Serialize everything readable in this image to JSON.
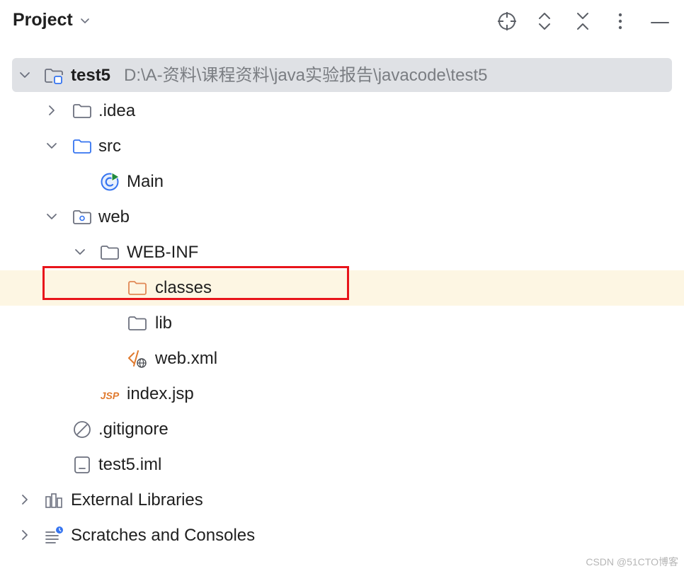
{
  "header": {
    "title": "Project",
    "toolbar": {
      "locate": "locate-icon",
      "expand": "expand-all-icon",
      "collapse": "collapse-all-icon",
      "more": "more-vertical-icon",
      "hide": "minimize-icon"
    }
  },
  "tree": {
    "root": {
      "name": "test5",
      "path": "D:\\A-资料\\课程资料\\java实验报告\\javacode\\test5"
    },
    "idea": {
      "name": ".idea"
    },
    "src": {
      "name": "src"
    },
    "main": {
      "name": "Main"
    },
    "web": {
      "name": "web"
    },
    "webinf": {
      "name": "WEB-INF"
    },
    "classes": {
      "name": "classes"
    },
    "lib": {
      "name": "lib"
    },
    "webxml": {
      "name": "web.xml"
    },
    "indexjsp": {
      "name": "index.jsp",
      "badge": "JSP"
    },
    "gitignore": {
      "name": ".gitignore"
    },
    "iml": {
      "name": "test5.iml"
    },
    "external": {
      "name": "External Libraries"
    },
    "scratches": {
      "name": "Scratches and Consoles"
    }
  },
  "colors": {
    "folder_stroke": "#6c707e",
    "source_folder_stroke": "#3574f0",
    "excluded_folder_stroke": "#e08855",
    "highlight_bg": "#fdf6e3",
    "selection_bg": "#dfe1e5",
    "annotation_red": "#e8151b"
  },
  "watermark": "CSDN @51CTO博客"
}
